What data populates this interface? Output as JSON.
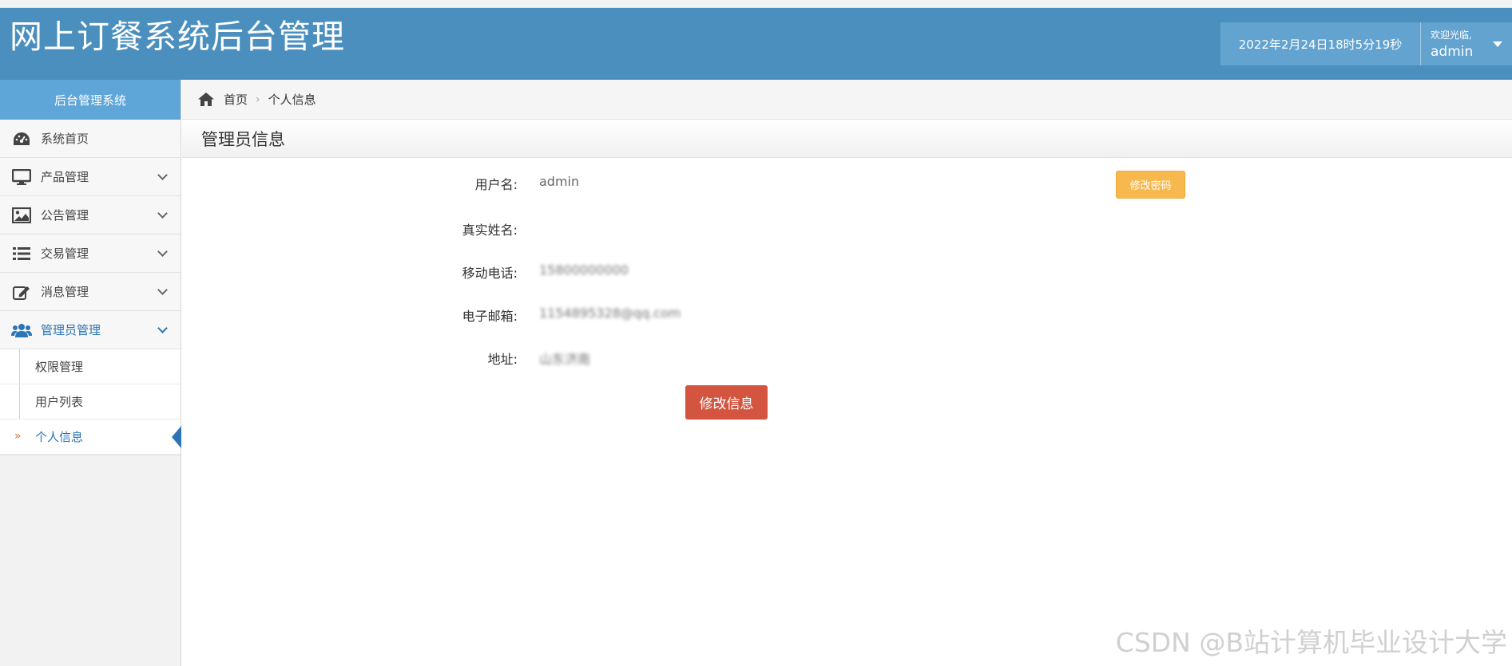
{
  "header": {
    "brand": "网上订餐系统后台管理",
    "datetime": "2022年2月24日18时5分19秒",
    "welcome": "欢迎光临,",
    "username": "admin"
  },
  "sidebar": {
    "title": "后台管理系统",
    "items": [
      {
        "label": "系统首页",
        "icon": "dashboard-icon"
      },
      {
        "label": "产品管理",
        "icon": "monitor-icon"
      },
      {
        "label": "公告管理",
        "icon": "image-icon"
      },
      {
        "label": "交易管理",
        "icon": "list-icon"
      },
      {
        "label": "消息管理",
        "icon": "edit-icon"
      },
      {
        "label": "管理员管理",
        "icon": "users-icon"
      }
    ],
    "subitems": [
      {
        "label": "权限管理"
      },
      {
        "label": "用户列表"
      },
      {
        "label": "个人信息"
      }
    ]
  },
  "breadcrumb": {
    "home": "首页",
    "current": "个人信息"
  },
  "page_title": "管理员信息",
  "form": {
    "username_label": "用户名:",
    "username_value": "admin",
    "realname_label": "真实姓名:",
    "realname_value": "",
    "phone_label": "移动电话:",
    "phone_value": "15800000000",
    "email_label": "电子邮箱:",
    "email_value": "1154895328@qq.com",
    "address_label": "地址:",
    "address_value": "山东济南",
    "change_password": "修改密码",
    "save": "修改信息"
  },
  "watermark": "CSDN @B站计算机毕业设计大学",
  "colors": {
    "header_bg": "#4a8fbd",
    "sidebar_head": "#5ea5d8",
    "active": "#2b74b6",
    "warn_button": "#f7b84e",
    "danger_button": "#d35540"
  }
}
